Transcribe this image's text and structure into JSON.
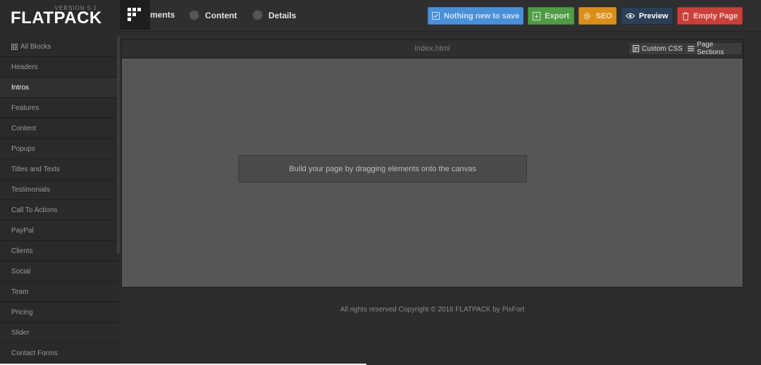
{
  "brand": {
    "version": "VERSION 5.1",
    "logo": "FLATPACK"
  },
  "tabs": [
    {
      "label": "ments",
      "icon": "radio-dot-icon"
    },
    {
      "label": "Content",
      "icon": "radio-dot-icon"
    },
    {
      "label": "Details",
      "icon": "radio-dot-icon"
    }
  ],
  "toolbar": {
    "save_label": "Nothing new to save",
    "export_label": "Export",
    "seo_label": "SEO",
    "preview_label": "Preview",
    "empty_label": "Empty Page"
  },
  "sidebar": {
    "items": [
      {
        "label": "All Blocks",
        "icon": "grid-icon"
      },
      {
        "label": "Headers"
      },
      {
        "label": "Intros",
        "active": true
      },
      {
        "label": "Features"
      },
      {
        "label": "Content"
      },
      {
        "label": "Popups"
      },
      {
        "label": "Titles and Texts"
      },
      {
        "label": "Testimonials"
      },
      {
        "label": "Call To Actions"
      },
      {
        "label": "PayPal"
      },
      {
        "label": "Clients"
      },
      {
        "label": "Social"
      },
      {
        "label": "Team"
      },
      {
        "label": "Pricing"
      },
      {
        "label": "Slider"
      },
      {
        "label": "Contact Forms"
      }
    ]
  },
  "canvas": {
    "file_name": "index.html",
    "custom_css_label": "Custom CSS",
    "page_sections_label": "Page Sections",
    "hint": "Build your page by dragging elements onto the canvas"
  },
  "footer": {
    "text": "All rights reserved Copyright © 2016 FLATPACK by PixFort"
  },
  "colors": {
    "save": "#4a90d9",
    "export": "#4f9c45",
    "seo": "#d8901b",
    "preview": "#2b3f57",
    "empty": "#c9403a"
  }
}
